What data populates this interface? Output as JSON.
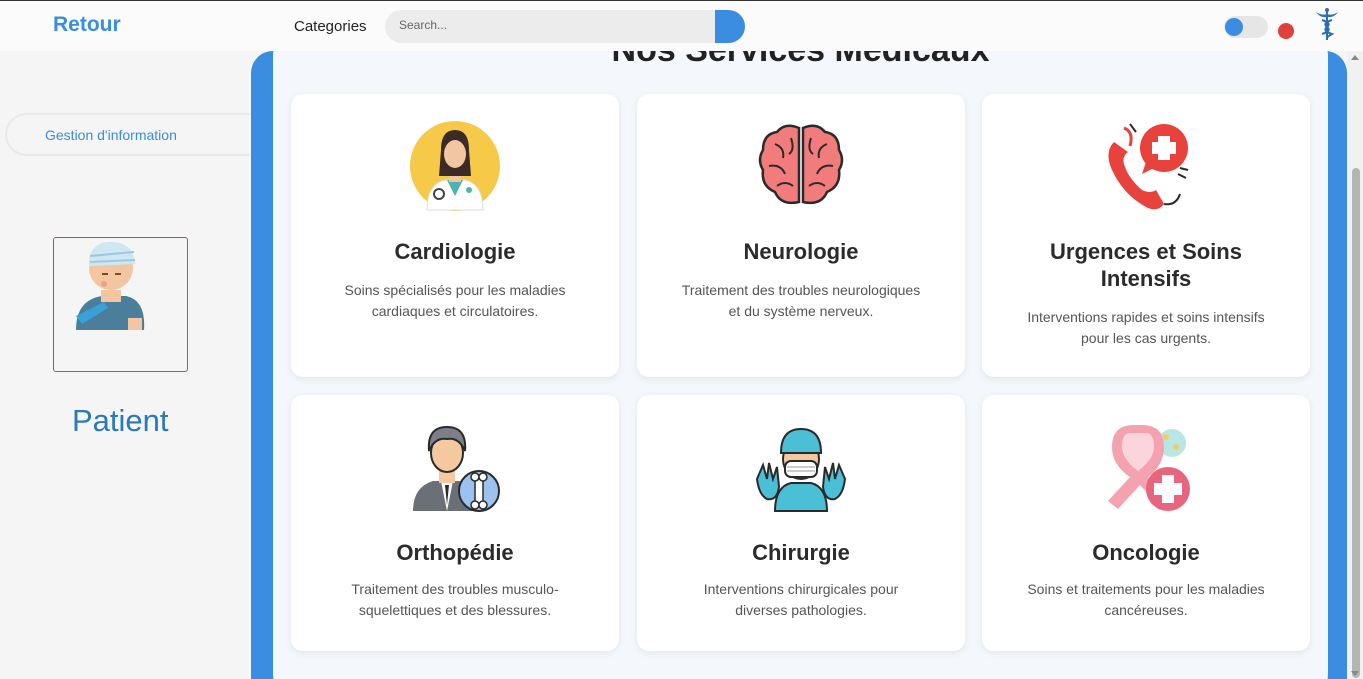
{
  "header": {
    "back_label": "Retour",
    "categories_label": "Categories",
    "search_placeholder": "Search..."
  },
  "sidebar": {
    "items": [
      {
        "label": "Gestion d'information"
      }
    ],
    "role_label": "Patient"
  },
  "main": {
    "title": "Nos Services Médicaux",
    "services": [
      {
        "name": "Cardiologie",
        "description": "Soins spécialisés pour les maladies cardiaques et circulatoires.",
        "icon": "doctor-icon"
      },
      {
        "name": "Neurologie",
        "description": "Traitement des troubles neurologiques et du système nerveux.",
        "icon": "brain-icon"
      },
      {
        "name": "Urgences et Soins Intensifs",
        "description": "Interventions rapides et soins intensifs pour les cas urgents.",
        "icon": "emergency-phone-icon"
      },
      {
        "name": "Orthopédie",
        "description": "Traitement des troubles musculo-squelettiques et des blessures.",
        "icon": "orthopedist-icon"
      },
      {
        "name": "Chirurgie",
        "description": "Interventions chirurgicales pour diverses pathologies.",
        "icon": "surgeon-icon"
      },
      {
        "name": "Oncologie",
        "description": "Soins et traitements pour les maladies cancéreuses.",
        "icon": "cancer-ribbon-icon"
      }
    ]
  },
  "colors": {
    "accent": "#3a8de0",
    "patient_text": "#2a7ab8",
    "notification_dot": "#e0403a"
  }
}
